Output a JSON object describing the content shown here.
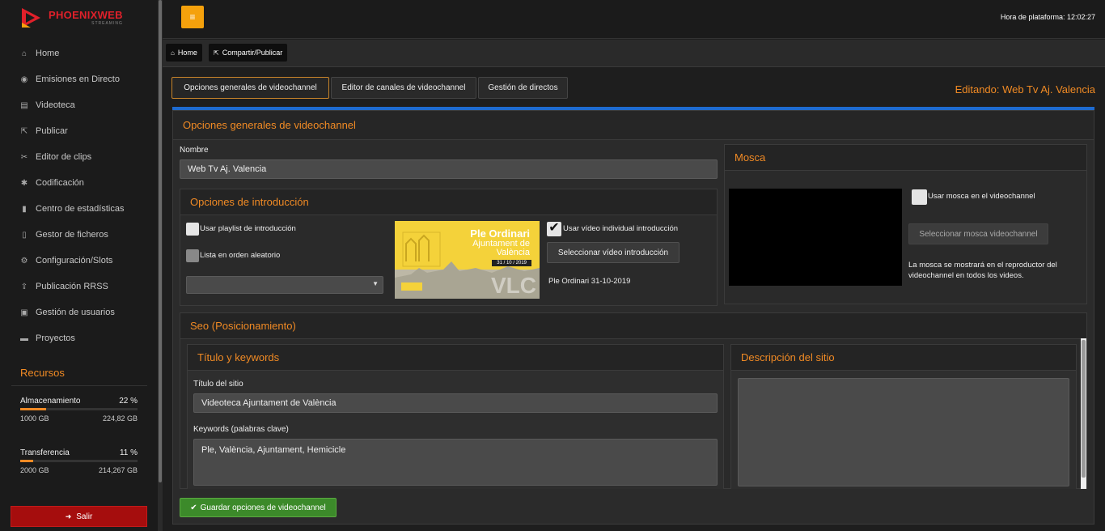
{
  "app": {
    "logo_text": "PHOENIXWEB",
    "logo_sub": "STREAMING"
  },
  "sidebar": {
    "items": [
      {
        "label": "Home",
        "icon": "home-icon"
      },
      {
        "label": "Emisiones en Directo",
        "icon": "camera-icon"
      },
      {
        "label": "Videoteca",
        "icon": "film-icon"
      },
      {
        "label": "Publicar",
        "icon": "share-icon"
      },
      {
        "label": "Editor de clips",
        "icon": "scissors-icon"
      },
      {
        "label": "Codificación",
        "icon": "gears-icon"
      },
      {
        "label": "Centro de estadísticas",
        "icon": "chart-icon"
      },
      {
        "label": "Gestor de ficheros",
        "icon": "file-icon"
      },
      {
        "label": "Configuración/Slots",
        "icon": "gear-icon"
      },
      {
        "label": "Publicación RRSS",
        "icon": "upload-icon"
      },
      {
        "label": "Gestión de usuarios",
        "icon": "lock-icon"
      },
      {
        "label": "Proyectos",
        "icon": "folder-icon"
      }
    ],
    "resources_title": "Recursos",
    "storage": {
      "label": "Almacenamiento",
      "percent_text": "22 %",
      "percent": 22,
      "total": "1000 GB",
      "used": "224,82 GB"
    },
    "transfer": {
      "label": "Transferencia",
      "percent_text": "11 %",
      "percent": 11,
      "total": "2000 GB",
      "used": "214,267 GB"
    },
    "logout_label": "Salir"
  },
  "topbar": {
    "clock": "Hora de plataforma: 12:02:27"
  },
  "breadcrumb": {
    "home": "Home",
    "current": "Compartir/Publicar"
  },
  "tabs": [
    {
      "label": "Opciones generales de videochannel",
      "active": true
    },
    {
      "label": "Editor de canales de videochannel",
      "active": false
    },
    {
      "label": "Gestión de directos",
      "active": false
    }
  ],
  "editing": "Editando: Web Tv Aj. Valencia",
  "main": {
    "title": "Opciones generales de videochannel",
    "name_label": "Nombre",
    "name_value": "Web Tv Aj. Valencia",
    "intro": {
      "title": "Opciones de introducción",
      "use_playlist": "Usar playlist de introducción",
      "random_list": "Lista en orden aleatorio",
      "use_single_video": "Usar vídeo individual introducción",
      "select_video_btn": "Seleccionar vídeo introducción",
      "video_name": "Ple Ordinari 31-10-2019",
      "thumb": {
        "title": "Ple Ordinari",
        "subtitle": "Ajuntament de València",
        "date": "31 / 10 / 2019",
        "mark": "VLC"
      }
    },
    "mosca": {
      "title": "Mosca",
      "use_label": "Usar mosca en el videochannel",
      "select_btn": "Seleccionar mosca videochannel",
      "note": "La mosca se mostrará en el reproductor del videochannel en todos los videos."
    },
    "seo": {
      "title": "Seo (Posicionamiento)",
      "title_kw": "Título y keywords",
      "site_title_label": "Título del sitio",
      "site_title_value": "Videoteca Ajuntament de València",
      "keywords_label": "Keywords (palabras clave)",
      "keywords_value": "Ple, València, Ajuntament, Hemicicle",
      "description_title": "Descripción del sitio"
    },
    "save_label": "Guardar opciones de videochannel"
  }
}
